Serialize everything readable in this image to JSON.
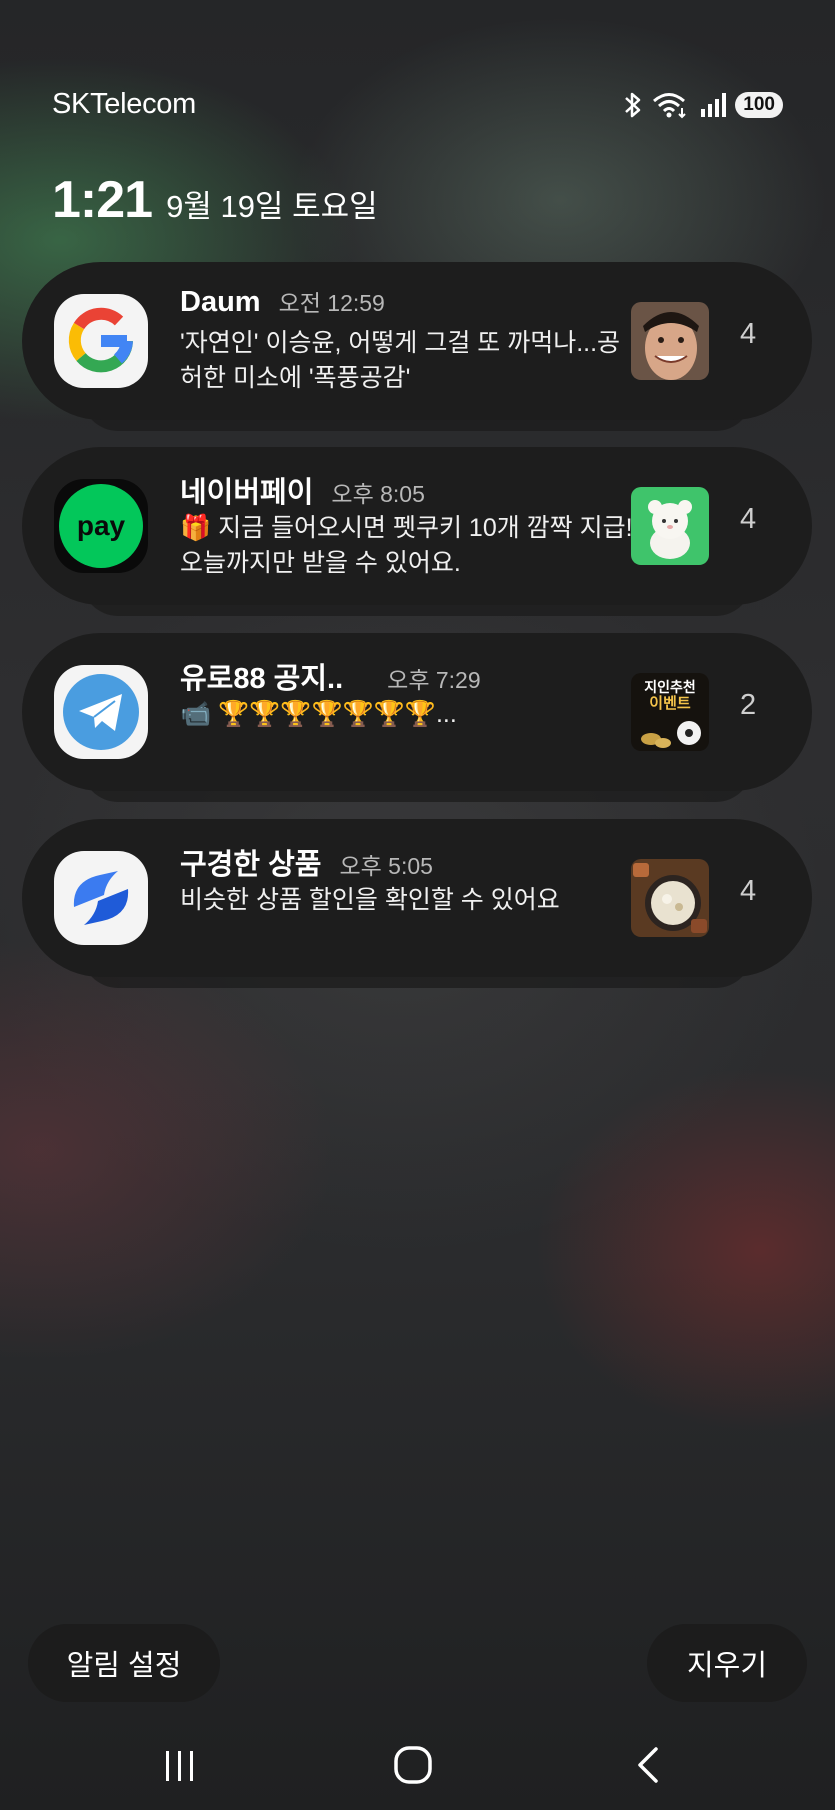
{
  "status_bar": {
    "carrier": "SKTelecom",
    "battery": "100"
  },
  "lock": {
    "time": "1:21",
    "date": "9월 19일 토요일"
  },
  "notifications": [
    {
      "app_icon": "google-icon",
      "title": "Daum",
      "time": "오전 12:59",
      "body": "'자연인' 이승윤, 어떻게 그걸 또 까먹나...공허한 미소에 '폭풍공감'",
      "thumb": "face-photo",
      "count": "4"
    },
    {
      "app_icon": "naver-pay-icon",
      "title": "네이버페이",
      "time": "오후 8:05",
      "body": "🎁 지금 들어오시면 펫쿠키 10개 깜짝 지급! 오늘까지만 받을 수 있어요.",
      "thumb": "bear-character",
      "count": "4"
    },
    {
      "app_icon": "telegram-icon",
      "title": "유로88 공지..",
      "time": "오후 7:29",
      "body": "📹 🏆🏆🏆🏆🏆🏆🏆...",
      "thumb": {
        "line1": "지인추천",
        "line2": "이벤트"
      },
      "count": "2"
    },
    {
      "app_icon": "coupang-icon",
      "title": "구경한 상품",
      "time": "오후 5:05",
      "body": "비슷한 상품 할인을 확인할 수 있어요",
      "thumb": "food-photo",
      "count": "4"
    }
  ],
  "buttons": {
    "settings": "알림 설정",
    "clear": "지우기"
  },
  "nav": [
    "recents-icon",
    "home-icon",
    "back-icon"
  ]
}
